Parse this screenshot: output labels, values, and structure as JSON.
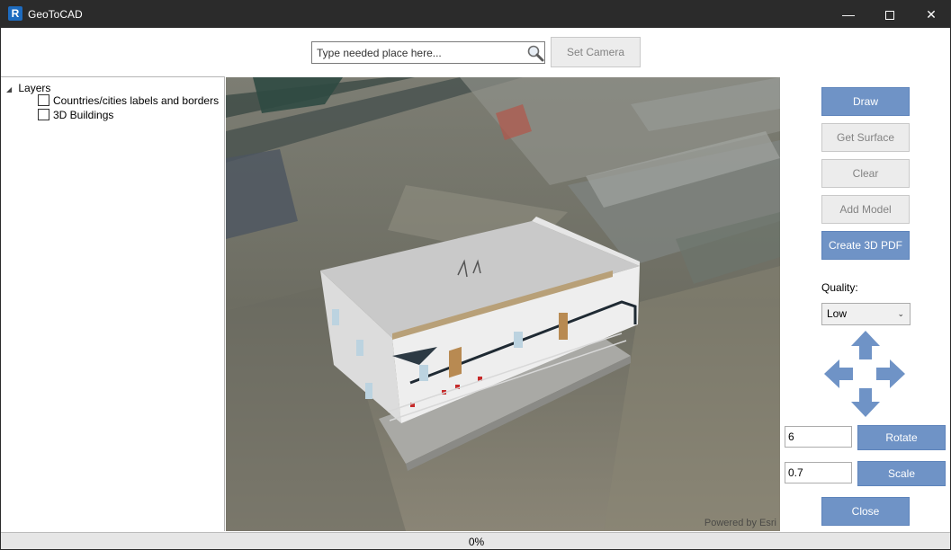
{
  "window": {
    "title": "GeoToCAD",
    "minimize_glyph": "—",
    "close_glyph": "✕"
  },
  "search": {
    "placeholder": "Type needed place here...",
    "value": ""
  },
  "toolbar": {
    "set_camera_label": "Set Camera"
  },
  "layers": {
    "root_label": "Layers",
    "items": [
      {
        "label": "Countries/cities labels and borders",
        "checked": false
      },
      {
        "label": "3D Buildings",
        "checked": false
      }
    ]
  },
  "map": {
    "attribution": "Powered by Esri"
  },
  "actions": {
    "draw_label": "Draw",
    "get_surface_label": "Get Surface",
    "clear_label": "Clear",
    "add_model_label": "Add Model",
    "create_pdf_label": "Create 3D PDF"
  },
  "quality": {
    "label": "Quality:",
    "selected": "Low"
  },
  "transform": {
    "rotate_value": "6",
    "rotate_label": "Rotate",
    "scale_value": "0.7",
    "scale_label": "Scale"
  },
  "close_label": "Close",
  "status": {
    "progress_text": "0%",
    "progress_fraction": 0
  },
  "colors": {
    "titlebar": "#2b2b2b",
    "accent_button": "#6f93c6",
    "arrow": "#6f93c6",
    "progress": "#06b025"
  }
}
